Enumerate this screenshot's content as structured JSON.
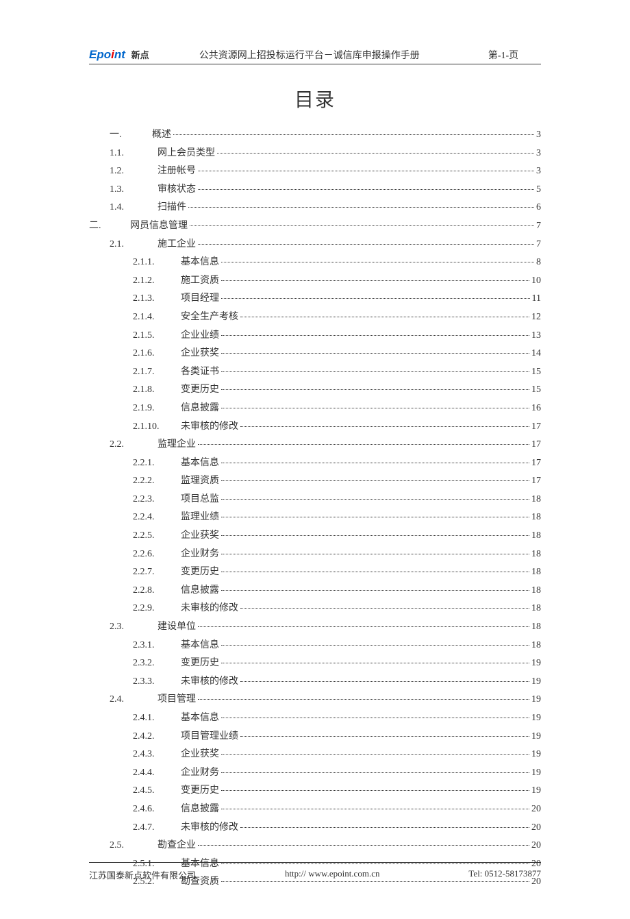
{
  "header": {
    "logo_en_prefix": "Epo",
    "logo_en_mid": "i",
    "logo_en_suffix": "nt",
    "logo_cn": "新点",
    "title": "公共资源网上招投标运行平台－诚信库申报操作手册",
    "page": "第-1-页"
  },
  "title": "目录",
  "toc": [
    {
      "num": "一.",
      "title": "概述",
      "page": "3",
      "level": 1
    },
    {
      "num": "1.1.",
      "title": "网上会员类型",
      "page": "3",
      "level": 2
    },
    {
      "num": "1.2.",
      "title": "注册帐号",
      "page": "3",
      "level": 2
    },
    {
      "num": "1.3.",
      "title": "审核状态",
      "page": "5",
      "level": 2
    },
    {
      "num": "1.4.",
      "title": "扫描件",
      "page": "6",
      "level": 2
    },
    {
      "num": "二.",
      "title": "网员信息管理",
      "page": "7",
      "level": 0
    },
    {
      "num": "2.1.",
      "title": "施工企业",
      "page": "7",
      "level": 2
    },
    {
      "num": "2.1.1.",
      "title": "基本信息",
      "page": "8",
      "level": 3
    },
    {
      "num": "2.1.2.",
      "title": "施工资质",
      "page": "10",
      "level": 3
    },
    {
      "num": "2.1.3.",
      "title": "项目经理",
      "page": "11",
      "level": 3
    },
    {
      "num": "2.1.4.",
      "title": "安全生产考核",
      "page": "12",
      "level": 3
    },
    {
      "num": "2.1.5.",
      "title": "企业业绩",
      "page": "13",
      "level": 3
    },
    {
      "num": "2.1.6.",
      "title": "企业获奖",
      "page": "14",
      "level": 3
    },
    {
      "num": "2.1.7.",
      "title": "各类证书",
      "page": "15",
      "level": 3
    },
    {
      "num": "2.1.8.",
      "title": "变更历史",
      "page": "15",
      "level": 3
    },
    {
      "num": "2.1.9.",
      "title": "信息披露",
      "page": "16",
      "level": 3
    },
    {
      "num": "2.1.10.",
      "title": "未审核的修改",
      "page": "17",
      "level": 3
    },
    {
      "num": "2.2.",
      "title": "监理企业",
      "page": "17",
      "level": 2
    },
    {
      "num": "2.2.1.",
      "title": "基本信息",
      "page": "17",
      "level": 3
    },
    {
      "num": "2.2.2.",
      "title": "监理资质",
      "page": "17",
      "level": 3
    },
    {
      "num": "2.2.3.",
      "title": "项目总监",
      "page": "18",
      "level": 3
    },
    {
      "num": "2.2.4.",
      "title": "监理业绩",
      "page": "18",
      "level": 3
    },
    {
      "num": "2.2.5.",
      "title": "企业获奖",
      "page": "18",
      "level": 3
    },
    {
      "num": "2.2.6.",
      "title": "企业财务",
      "page": "18",
      "level": 3
    },
    {
      "num": "2.2.7.",
      "title": "变更历史",
      "page": "18",
      "level": 3
    },
    {
      "num": "2.2.8.",
      "title": "信息披露",
      "page": "18",
      "level": 3
    },
    {
      "num": "2.2.9.",
      "title": "未审核的修改",
      "page": "18",
      "level": 3
    },
    {
      "num": "2.3.",
      "title": "建设单位",
      "page": "18",
      "level": 2
    },
    {
      "num": "2.3.1.",
      "title": "基本信息",
      "page": "18",
      "level": 3
    },
    {
      "num": "2.3.2.",
      "title": "变更历史",
      "page": "19",
      "level": 3
    },
    {
      "num": "2.3.3.",
      "title": "未审核的修改",
      "page": "19",
      "level": 3
    },
    {
      "num": "2.4.",
      "title": "项目管理",
      "page": "19",
      "level": 2
    },
    {
      "num": "2.4.1.",
      "title": "基本信息",
      "page": "19",
      "level": 3
    },
    {
      "num": "2.4.2.",
      "title": "项目管理业绩",
      "page": "19",
      "level": 3
    },
    {
      "num": "2.4.3.",
      "title": "企业获奖",
      "page": "19",
      "level": 3
    },
    {
      "num": "2.4.4.",
      "title": "企业财务",
      "page": "19",
      "level": 3
    },
    {
      "num": "2.4.5.",
      "title": "变更历史",
      "page": "19",
      "level": 3
    },
    {
      "num": "2.4.6.",
      "title": "信息披露",
      "page": "20",
      "level": 3
    },
    {
      "num": "2.4.7.",
      "title": "未审核的修改",
      "page": "20",
      "level": 3
    },
    {
      "num": "2.5.",
      "title": "勘查企业",
      "page": "20",
      "level": 2
    },
    {
      "num": "2.5.1.",
      "title": "基本信息",
      "page": "20",
      "level": 3
    },
    {
      "num": "2.5.2.",
      "title": "勘查资质",
      "page": "20",
      "level": 3
    }
  ],
  "footer": {
    "company": "江苏国泰新点软件有限公司",
    "url": "http:// www.epoint.com.cn",
    "tel": "Tel: 0512-58173877"
  }
}
